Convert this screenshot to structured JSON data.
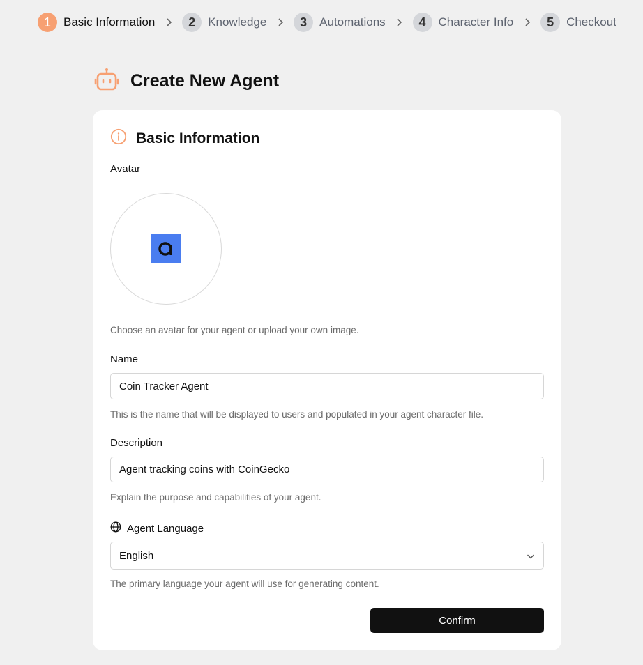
{
  "stepper": {
    "steps": [
      {
        "num": "1",
        "label": "Basic Information"
      },
      {
        "num": "2",
        "label": "Knowledge"
      },
      {
        "num": "3",
        "label": "Automations"
      },
      {
        "num": "4",
        "label": "Character Info"
      },
      {
        "num": "5",
        "label": "Checkout"
      }
    ],
    "active_step": 1
  },
  "page": {
    "title": "Create New Agent",
    "title_icon": "robot-icon"
  },
  "card": {
    "section_title": "Basic Information",
    "section_icon": "info-icon",
    "avatar": {
      "label": "Avatar",
      "hint": "Choose an avatar for your agent or upload your own image."
    },
    "name": {
      "label": "Name",
      "value": "Coin Tracker Agent",
      "hint": "This is the name that will be displayed to users and populated in your agent character file."
    },
    "description": {
      "label": "Description",
      "value": "Agent tracking coins with CoinGecko",
      "hint": "Explain the purpose and capabilities of your agent."
    },
    "language": {
      "label": "Agent Language",
      "icon": "globe-icon",
      "value": "English",
      "hint": "The primary language your agent will use for generating content."
    },
    "confirm_label": "Confirm"
  },
  "colors": {
    "accent": "#f7a072",
    "avatar_bg": "#4a7df0",
    "button_bg": "#111111",
    "page_bg": "#f0f0f0"
  }
}
